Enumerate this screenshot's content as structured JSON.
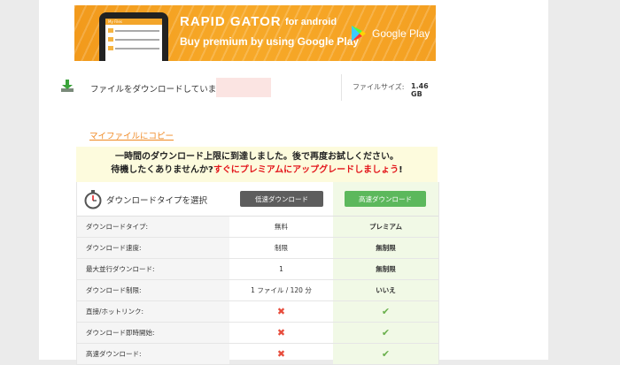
{
  "banner": {
    "brand": "RAPID GATOR",
    "brand_suffix": "for android",
    "tagline": "Buy premium by using Google Play",
    "store": "Google Play",
    "phone_title": "My Files",
    "colors": {
      "accent": "#f7a928",
      "free_button": "#5d5d5d",
      "premium_button": "#5cb85c",
      "alert": "#e3151a",
      "link": "#f08a24"
    }
  },
  "file": {
    "label": "ファイルをダウンロードしています:",
    "size_label": "ファイルサイズ:",
    "size_value": "1.46 GB"
  },
  "copy_link": "マイファイルにコピー",
  "notice": {
    "line1": "一時間のダウンロード上限に到達しました。後で再度お試しください。",
    "line2_prefix": "待機したくありませんか?",
    "line2_highlight": "すぐにプレミアムにアップグレードしましょう",
    "line2_suffix": "!"
  },
  "table": {
    "title": "ダウンロードタイプを選択",
    "free_button": "低速ダウンロード",
    "premium_button": "高速ダウンロード",
    "rows": [
      {
        "label": "ダウンロードタイプ:",
        "free": "無料",
        "premium": "プレミアム"
      },
      {
        "label": "ダウンロード速度:",
        "free": "制限",
        "premium": "無制限"
      },
      {
        "label": "最大並行ダウンロード:",
        "free": "1",
        "premium": "無制限"
      },
      {
        "label": "ダウンロード制限:",
        "free": "1 ファイル / 120 分",
        "premium": "いいえ"
      },
      {
        "label": "直接/ホットリンク:",
        "free": "✖",
        "premium": "✔"
      },
      {
        "label": "ダウンロード即時開始:",
        "free": "✖",
        "premium": "✔"
      },
      {
        "label": "高速ダウンロード:",
        "free": "✖",
        "premium": "✔"
      }
    ]
  }
}
